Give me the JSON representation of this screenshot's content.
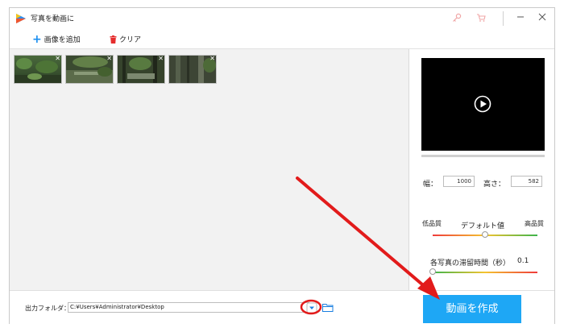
{
  "window": {
    "title": "写真を動画に"
  },
  "toolbar": {
    "add_label": "画像を追加",
    "clear_label": "クリア"
  },
  "thumbnails": [
    {
      "close": "✕"
    },
    {
      "close": "✕"
    },
    {
      "close": "✕"
    },
    {
      "close": "✕"
    }
  ],
  "preview": {
    "progress": 0
  },
  "settings": {
    "width_label": "幅：",
    "width_value": "1000",
    "height_label": "高さ：",
    "height_value": "582",
    "low_quality": "低品質",
    "default_label": "デフォルト値",
    "high_quality": "高品質",
    "quality_level": 0.5,
    "duration_label": "各写真の滞留時間（秒）",
    "duration_value": "0.1",
    "duration_level": 0
  },
  "output": {
    "label": "出力フォルダ：",
    "path": "C:¥Users¥Administrator¥Desktop",
    "create_button": "動画を作成"
  },
  "icons": [
    "app-logo-icon",
    "key-icon",
    "cart-icon",
    "minimize-icon",
    "close-icon",
    "plus-icon",
    "trash-icon",
    "play-icon",
    "chevron-down-icon",
    "folder-icon"
  ],
  "colors": {
    "accent": "#1ea7f5",
    "annotation": "#e21b1b",
    "trash": "#e52d2d"
  }
}
